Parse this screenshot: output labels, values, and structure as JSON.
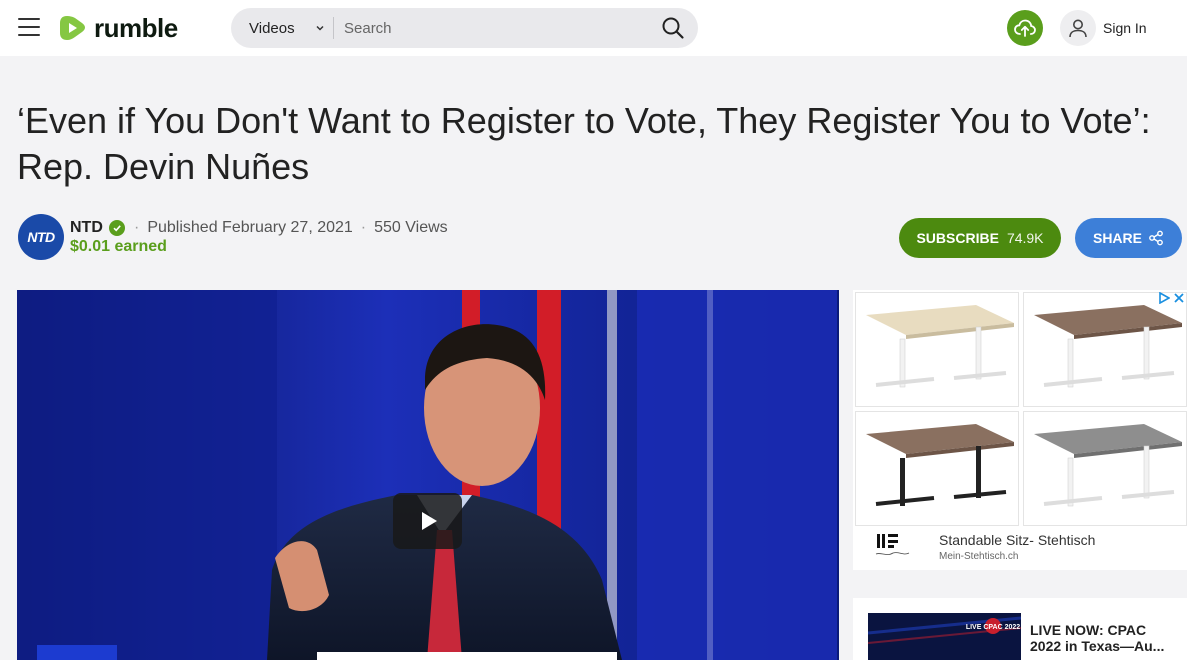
{
  "header": {
    "logo_text": "rumble",
    "search_category": "Videos",
    "search_placeholder": "Search",
    "signin_label": "Sign In",
    "colors": {
      "brand_green": "#85c742",
      "upload_green": "#5a9e1c"
    }
  },
  "video": {
    "title": "‘Even if You Don't Want to Register to Vote, They Register You to Vote’: Rep. Devin Nuñes",
    "channel_name": "NTD",
    "channel_avatar_text": "NTD",
    "published": "Published February 27, 2021",
    "views": "550 Views",
    "earned": "$0.01 earned",
    "subscribe_label": "SUBSCRIBE",
    "subscriber_count": "74.9K",
    "share_label": "SHARE"
  },
  "ad": {
    "title": "Standable Sitz- Stehtisch",
    "domain": "Mein-Stehtisch.ch"
  },
  "live": {
    "title": "LIVE NOW: CPAC 2022 in Texas—Au...",
    "thumb_caption": "LIVE CPAC 2022"
  }
}
